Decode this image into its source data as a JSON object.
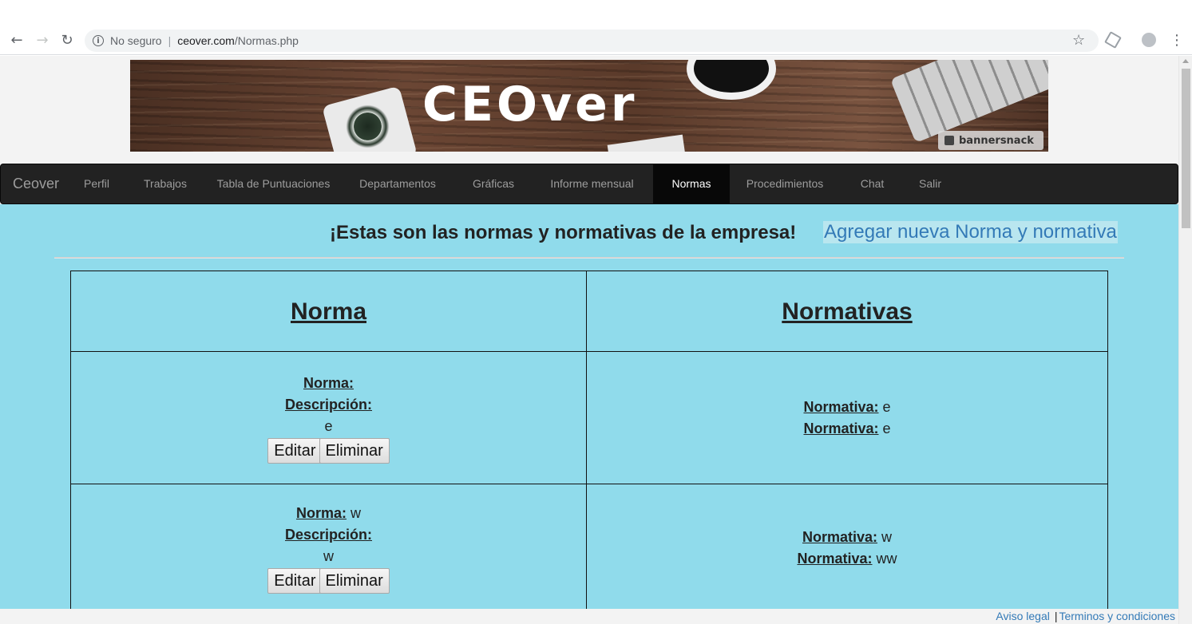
{
  "browser": {
    "security_label": "No seguro",
    "separator": "|",
    "url_host": "ceover.com",
    "url_path": "/Normas.php"
  },
  "banner": {
    "logo_text": "CEOver",
    "watermark": "bannersnack"
  },
  "navbar": {
    "brand": "Ceover",
    "items": [
      {
        "label": "Perfil"
      },
      {
        "label": "Trabajos"
      },
      {
        "label": "Tabla de Puntuaciones"
      },
      {
        "label": "Departamentos"
      },
      {
        "label": "Gráficas"
      },
      {
        "label": "Informe mensual"
      },
      {
        "label": "Normas",
        "active": true
      },
      {
        "label": "Procedimientos"
      },
      {
        "label": "Chat"
      },
      {
        "label": "Salir"
      }
    ]
  },
  "main": {
    "heading": "¡Estas son las normas y normativas de la empresa!",
    "add_link": "Agregar nueva Norma y normativa",
    "table": {
      "headers": [
        "Norma",
        "Normativa s"
      ],
      "rows": [
        {
          "norma_label": "Norma:",
          "norma_value": "",
          "descripcion_label": "Descripción:",
          "descripcion_value": "e",
          "edit_label": "Editar",
          "delete_label": "Eliminar",
          "normativas": [
            {
              "label": "Normativa:",
              "value": "e"
            },
            {
              "label": "Normativa:",
              "value": "e"
            }
          ]
        },
        {
          "norma_label": "Norma:",
          "norma_value": "w",
          "descripcion_label": "Descripción:",
          "descripcion_value": "w",
          "edit_label": "Editar",
          "delete_label": "Eliminar",
          "normativas": [
            {
              "label": "Normativa:",
              "value": "w"
            },
            {
              "label": "Normativa:",
              "value": "ww"
            }
          ]
        }
      ]
    }
  },
  "footer": {
    "aviso": "Aviso legal",
    "pipe": "|",
    "terminos": "Terminos y condiciones"
  },
  "colors": {
    "content_bg": "#90dbeb",
    "navbar_bg": "#222222",
    "link": "#337ab7"
  }
}
